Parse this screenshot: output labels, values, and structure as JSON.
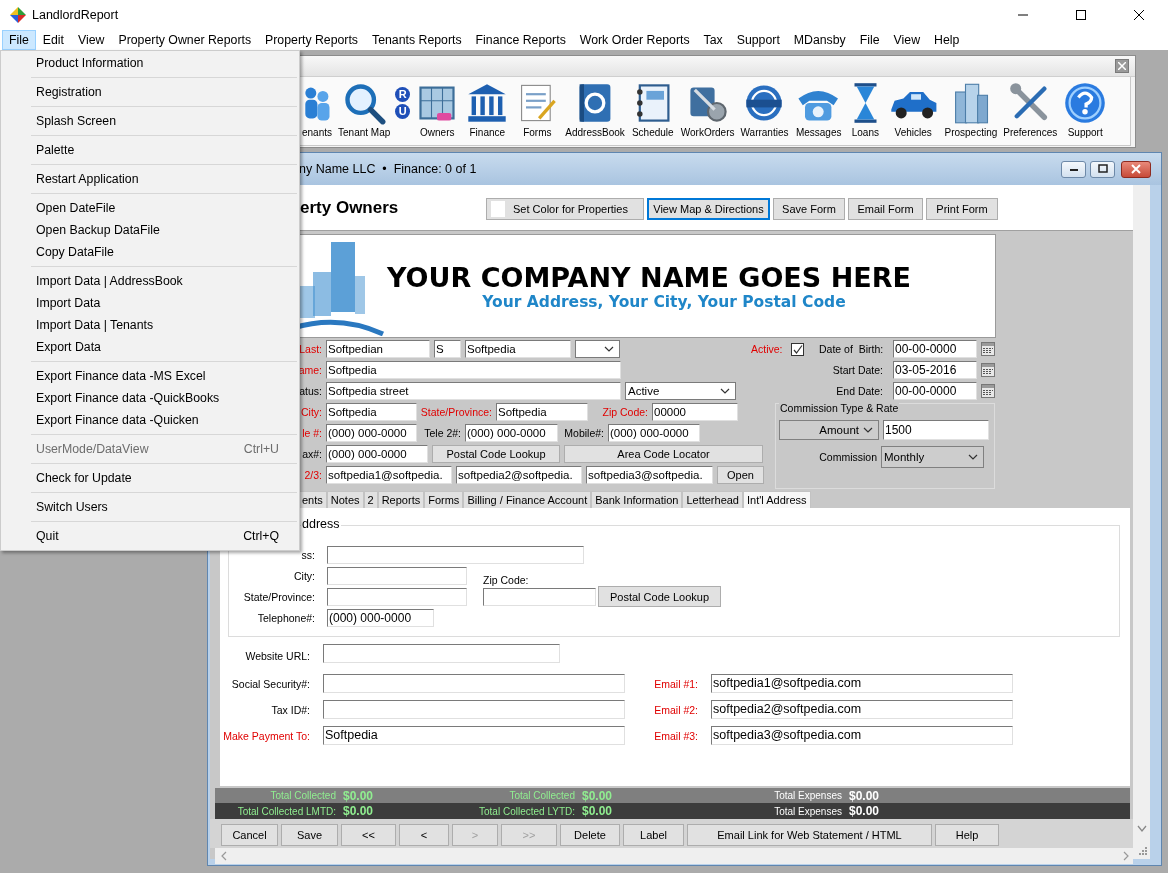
{
  "window": {
    "title": "LandlordReport"
  },
  "menu_bar": [
    {
      "label": "File",
      "selected": true
    },
    {
      "label": "Edit",
      "selected": false
    },
    {
      "label": "View",
      "selected": false
    },
    {
      "label": "Property Owner Reports",
      "selected": false
    },
    {
      "label": "Property Reports",
      "selected": false
    },
    {
      "label": "Tenants Reports",
      "selected": false
    },
    {
      "label": "Finance Reports",
      "selected": false
    },
    {
      "label": "Work Order Reports",
      "selected": false
    },
    {
      "label": "Tax",
      "selected": false
    },
    {
      "label": "Support",
      "selected": false
    },
    {
      "label": "MDansby",
      "selected": false
    },
    {
      "label": "File",
      "selected": false
    },
    {
      "label": "View",
      "selected": false
    },
    {
      "label": "Help",
      "selected": false
    }
  ],
  "file_menu": {
    "groups": [
      [
        {
          "label": "Product Information",
          "disabled": false
        }
      ],
      [
        {
          "label": "Registration",
          "disabled": false
        }
      ],
      [
        {
          "label": "Splash Screen",
          "disabled": false
        }
      ],
      [
        {
          "label": "Palette",
          "disabled": false
        }
      ],
      [
        {
          "label": "Restart Application",
          "disabled": false
        }
      ],
      [
        {
          "label": "Open DateFile",
          "disabled": false
        },
        {
          "label": "Open Backup DataFile",
          "disabled": false
        },
        {
          "label": "Copy DataFile",
          "disabled": false
        }
      ],
      [
        {
          "label": "Import Data | AddressBook",
          "disabled": false
        },
        {
          "label": "Import Data",
          "disabled": false
        },
        {
          "label": "Import Data | Tenants",
          "disabled": false
        },
        {
          "label": "Export Data",
          "disabled": false
        }
      ],
      [
        {
          "label": "Export Finance data -MS Excel",
          "disabled": false
        },
        {
          "label": "Export Finance data -QuickBooks",
          "disabled": false
        },
        {
          "label": "Export Finance data -Quicken",
          "disabled": false
        }
      ],
      [
        {
          "label": "UserMode/DataView",
          "shortcut": "Ctrl+U",
          "disabled": true
        }
      ],
      [
        {
          "label": "Check for Update",
          "disabled": false
        }
      ],
      [
        {
          "label": "Switch Users",
          "disabled": false
        }
      ],
      [
        {
          "label": "Quit",
          "shortcut": "Ctrl+Q",
          "disabled": false
        }
      ]
    ]
  },
  "toolbar": {
    "items": [
      {
        "kind": "tenants",
        "label": "enants"
      },
      {
        "kind": "map",
        "label": "Tenant Map"
      },
      {
        "kind": "letters",
        "letters": [
          "R",
          "U"
        ]
      },
      {
        "kind": "owners",
        "label": "Owners"
      },
      {
        "kind": "finance",
        "label": "Finance"
      },
      {
        "kind": "forms",
        "label": "Forms"
      },
      {
        "kind": "addressbook",
        "label": "AddressBook"
      },
      {
        "kind": "schedule",
        "label": "Schedule"
      },
      {
        "kind": "workorders",
        "label": "WorkOrders"
      },
      {
        "kind": "warranties",
        "label": "Warranties"
      },
      {
        "kind": "messages",
        "label": "Messages"
      },
      {
        "kind": "loans",
        "label": "Loans"
      },
      {
        "kind": "vehicles",
        "label": "Vehicles"
      },
      {
        "kind": "prospecting",
        "label": "Prospecting"
      },
      {
        "kind": "preferences",
        "label": "Preferences"
      },
      {
        "kind": "support",
        "label": "Support"
      }
    ]
  },
  "owner_window": {
    "title": "ny Name LLC  •  Finance: 0 of 1",
    "heading": "erty Owners",
    "header_buttons": [
      {
        "label": "Set Color for Properties",
        "kind": "swatch",
        "focused": false
      },
      {
        "label": "View Map & Directions",
        "kind": "plain",
        "focused": true
      },
      {
        "label": "Save Form",
        "kind": "plain",
        "focused": false
      },
      {
        "label": "Email Form",
        "kind": "plain",
        "focused": false
      },
      {
        "label": "Print Form",
        "kind": "plain",
        "focused": false
      }
    ]
  },
  "banner": {
    "company": "YOUR COMPANY NAME GOES HERE",
    "address": "Your Address, Your City, Your Postal Code"
  },
  "owner_form": {
    "lines": [
      {
        "groups": [
          {
            "label": "Last:",
            "required": true,
            "controls": [
              {
                "kind": "input",
                "value": "Softpedian"
              },
              {
                "kind": "input",
                "value": "S"
              },
              {
                "kind": "input",
                "value": "Softpedia"
              },
              {
                "kind": "select"
              }
            ]
          }
        ]
      },
      {
        "groups": [
          {
            "label": "ame:",
            "required": true,
            "controls": [
              {
                "kind": "input",
                "value": "Softpedia"
              }
            ]
          }
        ]
      },
      {
        "groups": [
          {
            "label": "atus:",
            "required": false,
            "controls": [
              {
                "kind": "input",
                "value": "Softpedia street"
              },
              {
                "kind": "select",
                "value": "Active"
              }
            ]
          }
        ]
      },
      {
        "groups": [
          {
            "label": "City:",
            "required": true,
            "controls": [
              {
                "kind": "input",
                "value": "Softpedia"
              }
            ]
          },
          {
            "label": "State/Province:",
            "required": true,
            "controls": [
              {
                "kind": "input",
                "value": "Softpedia"
              }
            ]
          },
          {
            "label": "Zip Code:",
            "required": true,
            "controls": [
              {
                "kind": "input",
                "value": "00000"
              }
            ]
          }
        ]
      },
      {
        "groups": [
          {
            "label": "le #:",
            "required": true,
            "controls": [
              {
                "kind": "input",
                "value": "(000) 000-0000"
              }
            ]
          },
          {
            "label": "Tele 2#:",
            "required": false,
            "controls": [
              {
                "kind": "input",
                "value": "(000) 000-0000"
              }
            ]
          },
          {
            "label": "Mobile#:",
            "required": false,
            "controls": [
              {
                "kind": "input",
                "value": "(000) 000-0000"
              }
            ]
          }
        ]
      },
      {
        "groups": [
          {
            "label": "ax#:",
            "required": false,
            "controls": [
              {
                "kind": "input",
                "value": "(000) 000-0000"
              },
              {
                "kind": "button",
                "label": "Postal Code Lookup"
              },
              {
                "kind": "button",
                "label": "Area Code Locator"
              }
            ]
          }
        ]
      },
      {
        "groups": [
          {
            "label": "2/3:",
            "required": true,
            "controls": [
              {
                "kind": "input",
                "value": "softpedia1@softpedia."
              },
              {
                "kind": "input",
                "value": "softpedia2@softpedia."
              },
              {
                "kind": "input",
                "value": "softpedia3@softpedia."
              },
              {
                "kind": "button",
                "label": "Open"
              }
            ]
          }
        ]
      }
    ]
  },
  "active": {
    "label": "Active:",
    "checked": true
  },
  "dates": [
    {
      "label": "Date of  Birth:",
      "value": "00-00-0000"
    },
    {
      "label": "Start Date:",
      "value": "03-05-2016"
    },
    {
      "label": "End Date:",
      "value": "00-00-0000"
    }
  ],
  "commission": {
    "legend": "Commission Type & Rate",
    "type": "Amount",
    "rate": "1500",
    "label": "Commission",
    "period": "Monthly"
  },
  "tabs": [
    {
      "label": "ents",
      "selected": false
    },
    {
      "label": "Notes",
      "selected": false
    },
    {
      "label": "2",
      "selected": false
    },
    {
      "label": "Reports",
      "selected": false
    },
    {
      "label": "Forms",
      "selected": false
    },
    {
      "label": "Billing / Finance Account",
      "selected": false
    },
    {
      "label": "Bank Information",
      "selected": false
    },
    {
      "label": "Letterhead",
      "selected": false
    },
    {
      "label": "Int'l Address",
      "selected": true
    }
  ],
  "address": {
    "legend": "ddress",
    "fields": [
      {
        "label": "ss:"
      },
      {
        "label": "City:"
      },
      {
        "label": "State/Province:"
      },
      {
        "label": "Telephone#:",
        "value": "(000) 000-0000"
      }
    ],
    "zip_label": "Zip Code:",
    "lookup": "Postal Code Lookup"
  },
  "contact": {
    "website": {
      "label": "Website URL:",
      "required": false
    },
    "left": [
      {
        "label": "Social Security#:",
        "required": false
      },
      {
        "label": "Tax ID#:",
        "required": false
      },
      {
        "label": "Make Payment To:",
        "required": true,
        "value": "Softpedia"
      }
    ],
    "right": [
      {
        "label": "Email #1:",
        "required": true,
        "value": "softpedia1@softpedia.com"
      },
      {
        "label": "Email #2:",
        "required": true,
        "value": "softpedia2@softpedia.com"
      },
      {
        "label": "Email #3:",
        "required": true,
        "value": "softpedia3@softpedia.com"
      }
    ]
  },
  "totals": [
    [
      {
        "label": "Total Collected",
        "value": "$0.00",
        "color": "#90ee90"
      },
      {
        "label": "Total Collected",
        "value": "$0.00",
        "color": "#90ee90"
      },
      {
        "label": "Total Expenses",
        "value": "$0.00",
        "color": "#ffffff"
      }
    ],
    [
      {
        "label": "Total Collected LMTD:",
        "value": "$0.00",
        "color": "#90ee90"
      },
      {
        "label": "Total Collected LYTD:",
        "value": "$0.00",
        "color": "#90ee90"
      },
      {
        "label": "Total Expenses",
        "value": "$0.00",
        "color": "#ffffff"
      }
    ]
  ],
  "buttons": [
    {
      "label": "Cancel",
      "disabled": false
    },
    {
      "label": "Save",
      "disabled": false
    },
    {
      "label": "<<",
      "disabled": false
    },
    {
      "label": "<",
      "disabled": false
    },
    {
      "label": ">",
      "disabled": true
    },
    {
      "label": ">>",
      "disabled": true
    },
    {
      "label": "Delete",
      "disabled": false
    },
    {
      "label": "Label",
      "disabled": false
    },
    {
      "label": "Email Link for Web Statement / HTML",
      "disabled": false
    },
    {
      "label": "Help",
      "disabled": false
    }
  ]
}
